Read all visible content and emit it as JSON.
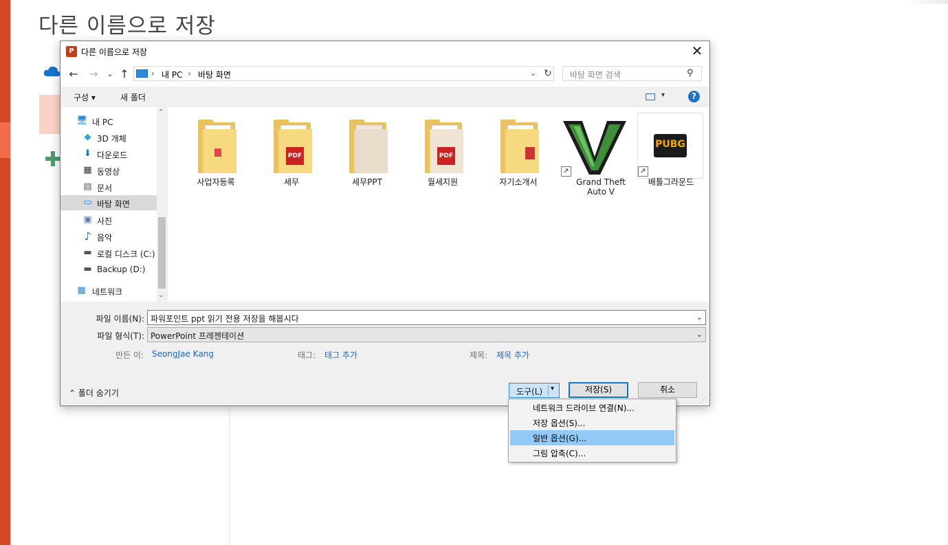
{
  "backstage": {
    "title": "다른 이름으로 저장"
  },
  "dialog": {
    "title": "다른 이름으로 저장",
    "app_icon_letter": "P",
    "close_glyph": "✕"
  },
  "navigation": {
    "back_glyph": "←",
    "forward_glyph": "→",
    "recent_glyph": "⌄",
    "up_glyph": "↑",
    "address": {
      "sep": "›",
      "pc": "내 PC",
      "folder": "바탕 화면",
      "dropdown_glyph": "⌄",
      "refresh_glyph": "↻"
    },
    "search": {
      "placeholder": "바탕 화면 검색",
      "icon_glyph": "⚲"
    }
  },
  "toolbar": {
    "organize": "구성 ▾",
    "new_folder": "새 폴더",
    "view_dropdown_glyph": "▾",
    "help_glyph": "?"
  },
  "nav_pane": {
    "items": [
      {
        "label": "내 PC",
        "icon": "pc-icon",
        "glyph": "🖥"
      },
      {
        "label": "3D 개체",
        "icon": "3d-objects-icon",
        "glyph": "◆"
      },
      {
        "label": "다운로드",
        "icon": "download-icon",
        "glyph": "⬇"
      },
      {
        "label": "동영상",
        "icon": "video-icon",
        "glyph": "▦"
      },
      {
        "label": "문서",
        "icon": "document-icon",
        "glyph": "▤"
      },
      {
        "label": "바탕 화면",
        "icon": "desktop-icon",
        "glyph": "▭"
      },
      {
        "label": "사진",
        "icon": "pictures-icon",
        "glyph": "▣"
      },
      {
        "label": "음악",
        "icon": "music-icon",
        "glyph": "♪"
      },
      {
        "label": "로컬 디스크 (C:)",
        "icon": "local-disk-icon",
        "glyph": "▬"
      },
      {
        "label": "Backup (D:)",
        "icon": "drive-icon",
        "glyph": "▬"
      },
      {
        "label": "네트워크",
        "icon": "network-icon",
        "glyph": "▩"
      }
    ],
    "scroll_up_glyph": "⌃",
    "scroll_down_glyph": "⌄"
  },
  "files": [
    {
      "label": "사업자등록",
      "kind": "folder"
    },
    {
      "label": "세무",
      "kind": "folder",
      "badge": "PDF"
    },
    {
      "label": "세무PPT",
      "kind": "folder"
    },
    {
      "label": "월세지원",
      "kind": "folder",
      "badge": "PDF"
    },
    {
      "label": "자기소개서",
      "kind": "folder"
    },
    {
      "label": "Grand Theft Auto V",
      "kind": "shortcut",
      "shortcut_glyph": "↗"
    },
    {
      "label": "배틀그라운드",
      "kind": "shortcut",
      "logo_text": "PUBG",
      "shortcut_glyph": "↗"
    }
  ],
  "form": {
    "filename_label": "파일 이름(N):",
    "filename_value": "파워포인트 ppt 읽기 전용 저장을 해봅시다",
    "filetype_label": "파일 형식(T):",
    "filetype_value": "PowerPoint 프레젠테이션",
    "dropdown_glyph": "⌄",
    "authors_label": "만든 이:",
    "authors_value": "SeongJae Kang",
    "tags_label": "태그:",
    "tags_value": "태그 추가",
    "title_label": "제목:",
    "title_value": "제목 추가"
  },
  "footer": {
    "hide_folders": "⌃ 폴더 숨기기",
    "tools": "도구(L)",
    "tools_arrow": "▾",
    "save": "저장(S)",
    "cancel": "취소",
    "grip": "⋰"
  },
  "tools_menu": {
    "items": [
      {
        "label": "네트워크 드라이브 연결(N)..."
      },
      {
        "label": "저장 옵션(S)..."
      },
      {
        "label": "일반 옵션(G)...",
        "highlighted": true
      },
      {
        "label": "그림 압축(C)..."
      }
    ]
  }
}
